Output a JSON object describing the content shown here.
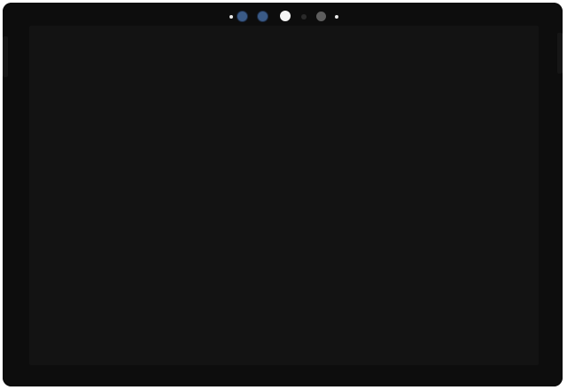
{
  "colors": {
    "page_background": "#ffffff",
    "bezel": "#0d0d0d",
    "bezel_edge": "#060606",
    "screen": "#131313",
    "camera_lens_blue": "#3a5a86",
    "camera_lens_blue_ring": "#1c2b44",
    "front_camera_white": "#f4f4f4",
    "ambient_sensor": "#2a2a2a",
    "ir_emitter_gray": "#5e5e5e",
    "indicator_led": "#e8e8e8",
    "side_button": "#161616"
  },
  "icons": {
    "left_led": "indicator-led-icon",
    "ir_camera_1": "ir-camera-icon",
    "ir_camera_2": "ir-camera-icon",
    "front_camera": "front-camera-icon",
    "ambient_light_sensor": "ambient-light-sensor-icon",
    "ir_emitter": "ir-emitter-icon",
    "right_led": "indicator-led-icon"
  }
}
